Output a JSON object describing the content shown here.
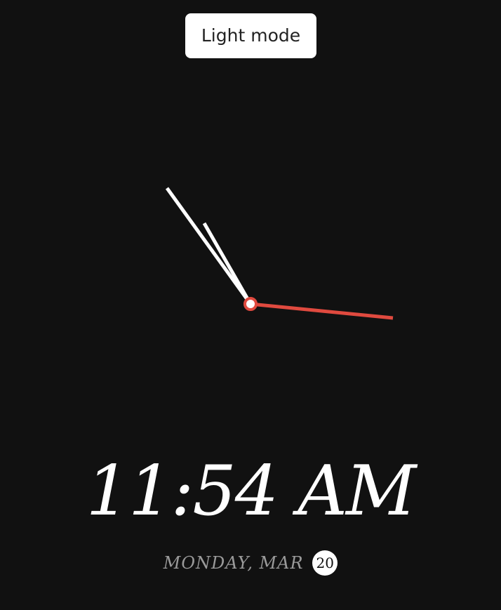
{
  "mode_toggle": {
    "label": "Light mode"
  },
  "clock": {
    "hand_colors": {
      "hour": "#ffffff",
      "minute": "#ffffff",
      "second": "#e04a3f",
      "center": "#e04a3f"
    }
  },
  "time": {
    "text": "11:54 AM"
  },
  "date": {
    "text": "MONDAY, MAR",
    "day": "20"
  }
}
